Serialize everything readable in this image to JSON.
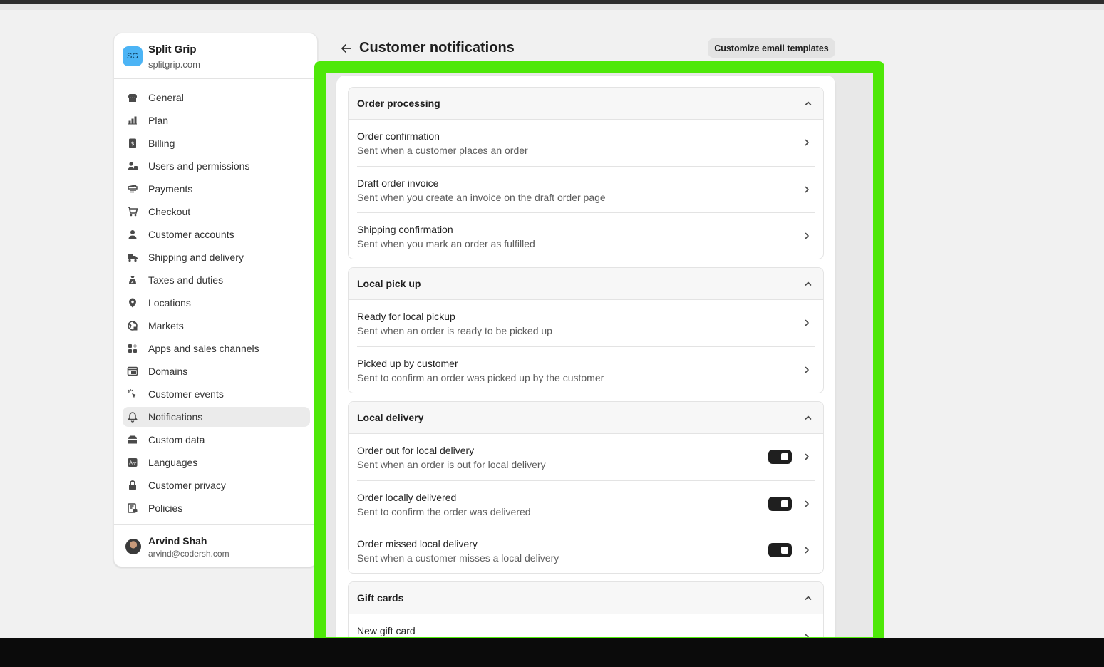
{
  "store": {
    "initials": "SG",
    "name": "Split Grip",
    "domain": "splitgrip.com"
  },
  "nav": [
    {
      "label": "General",
      "icon": "store-icon"
    },
    {
      "label": "Plan",
      "icon": "plan-icon"
    },
    {
      "label": "Billing",
      "icon": "billing-icon"
    },
    {
      "label": "Users and permissions",
      "icon": "users-icon"
    },
    {
      "label": "Payments",
      "icon": "payments-icon"
    },
    {
      "label": "Checkout",
      "icon": "cart-icon"
    },
    {
      "label": "Customer accounts",
      "icon": "person-icon"
    },
    {
      "label": "Shipping and delivery",
      "icon": "truck-icon"
    },
    {
      "label": "Taxes and duties",
      "icon": "tax-icon"
    },
    {
      "label": "Locations",
      "icon": "location-icon"
    },
    {
      "label": "Markets",
      "icon": "globe-icon"
    },
    {
      "label": "Apps and sales channels",
      "icon": "apps-icon"
    },
    {
      "label": "Domains",
      "icon": "domain-icon"
    },
    {
      "label": "Customer events",
      "icon": "cursor-icon"
    },
    {
      "label": "Notifications",
      "icon": "bell-icon",
      "active": true
    },
    {
      "label": "Custom data",
      "icon": "database-icon"
    },
    {
      "label": "Languages",
      "icon": "language-icon"
    },
    {
      "label": "Customer privacy",
      "icon": "lock-icon"
    },
    {
      "label": "Policies",
      "icon": "policy-icon"
    }
  ],
  "user": {
    "name": "Arvind Shah",
    "email": "arvind@codersh.com"
  },
  "header": {
    "title": "Customer notifications",
    "customize_label": "Customize email templates"
  },
  "sections": [
    {
      "title": "Order processing",
      "rows": [
        {
          "title": "Order confirmation",
          "desc": "Sent when a customer places an order"
        },
        {
          "title": "Draft order invoice",
          "desc": "Sent when you create an invoice on the draft order page"
        },
        {
          "title": "Shipping confirmation",
          "desc": "Sent when you mark an order as fulfilled"
        }
      ]
    },
    {
      "title": "Local pick up",
      "rows": [
        {
          "title": "Ready for local pickup",
          "desc": "Sent when an order is ready to be picked up"
        },
        {
          "title": "Picked up by customer",
          "desc": "Sent to confirm an order was picked up by the customer"
        }
      ]
    },
    {
      "title": "Local delivery",
      "rows": [
        {
          "title": "Order out for local delivery",
          "desc": "Sent when an order is out for local delivery",
          "toggle": true
        },
        {
          "title": "Order locally delivered",
          "desc": "Sent to confirm the order was delivered",
          "toggle": true
        },
        {
          "title": "Order missed local delivery",
          "desc": "Sent when a customer misses a local delivery",
          "toggle": true
        }
      ]
    },
    {
      "title": "Gift cards",
      "rows": [
        {
          "title": "New gift card",
          "desc": ""
        }
      ]
    }
  ],
  "colors": {
    "highlight": "#4ee808",
    "accent_dark": "#1f1f1f",
    "store_avatar": "#4cb4f5"
  }
}
